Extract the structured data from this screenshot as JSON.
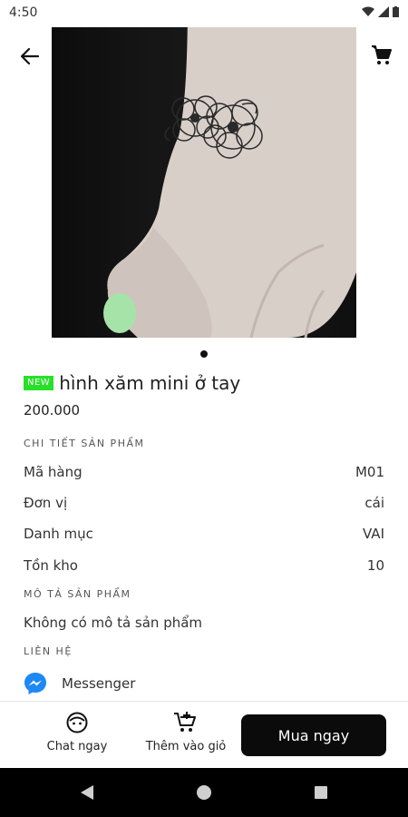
{
  "status_bar": {
    "time": "4:50"
  },
  "header": {
    "back_icon": "arrow-left-icon",
    "cart_icon": "shopping-cart-icon"
  },
  "product": {
    "badge": "NEW",
    "title": "hình xăm mini ở tay",
    "price": "200.000",
    "image_pager": {
      "count": 1,
      "active": 1
    }
  },
  "details": {
    "section_title": "CHI TIẾT SẢN PHẨM",
    "rows": [
      {
        "label": "Mã hàng",
        "value": "M01"
      },
      {
        "label": "Đơn vị",
        "value": "cái"
      },
      {
        "label": "Danh mục",
        "value": "VAI"
      },
      {
        "label": "Tồn kho",
        "value": "10"
      }
    ]
  },
  "description": {
    "section_title": "MÔ TẢ SẢN PHẨM",
    "text": "Không có mô tả sản phẩm"
  },
  "contact": {
    "section_title": "LIÊN HỆ",
    "messenger_label": "Messenger"
  },
  "bottom_bar": {
    "chat_label": "Chat ngay",
    "add_to_cart_label": "Thêm vào giỏ",
    "buy_label": "Mua ngay"
  },
  "colors": {
    "badge_bg": "#28e02a",
    "buy_button_bg": "#0b0b0b",
    "messenger_blue": "#1e88f5"
  }
}
